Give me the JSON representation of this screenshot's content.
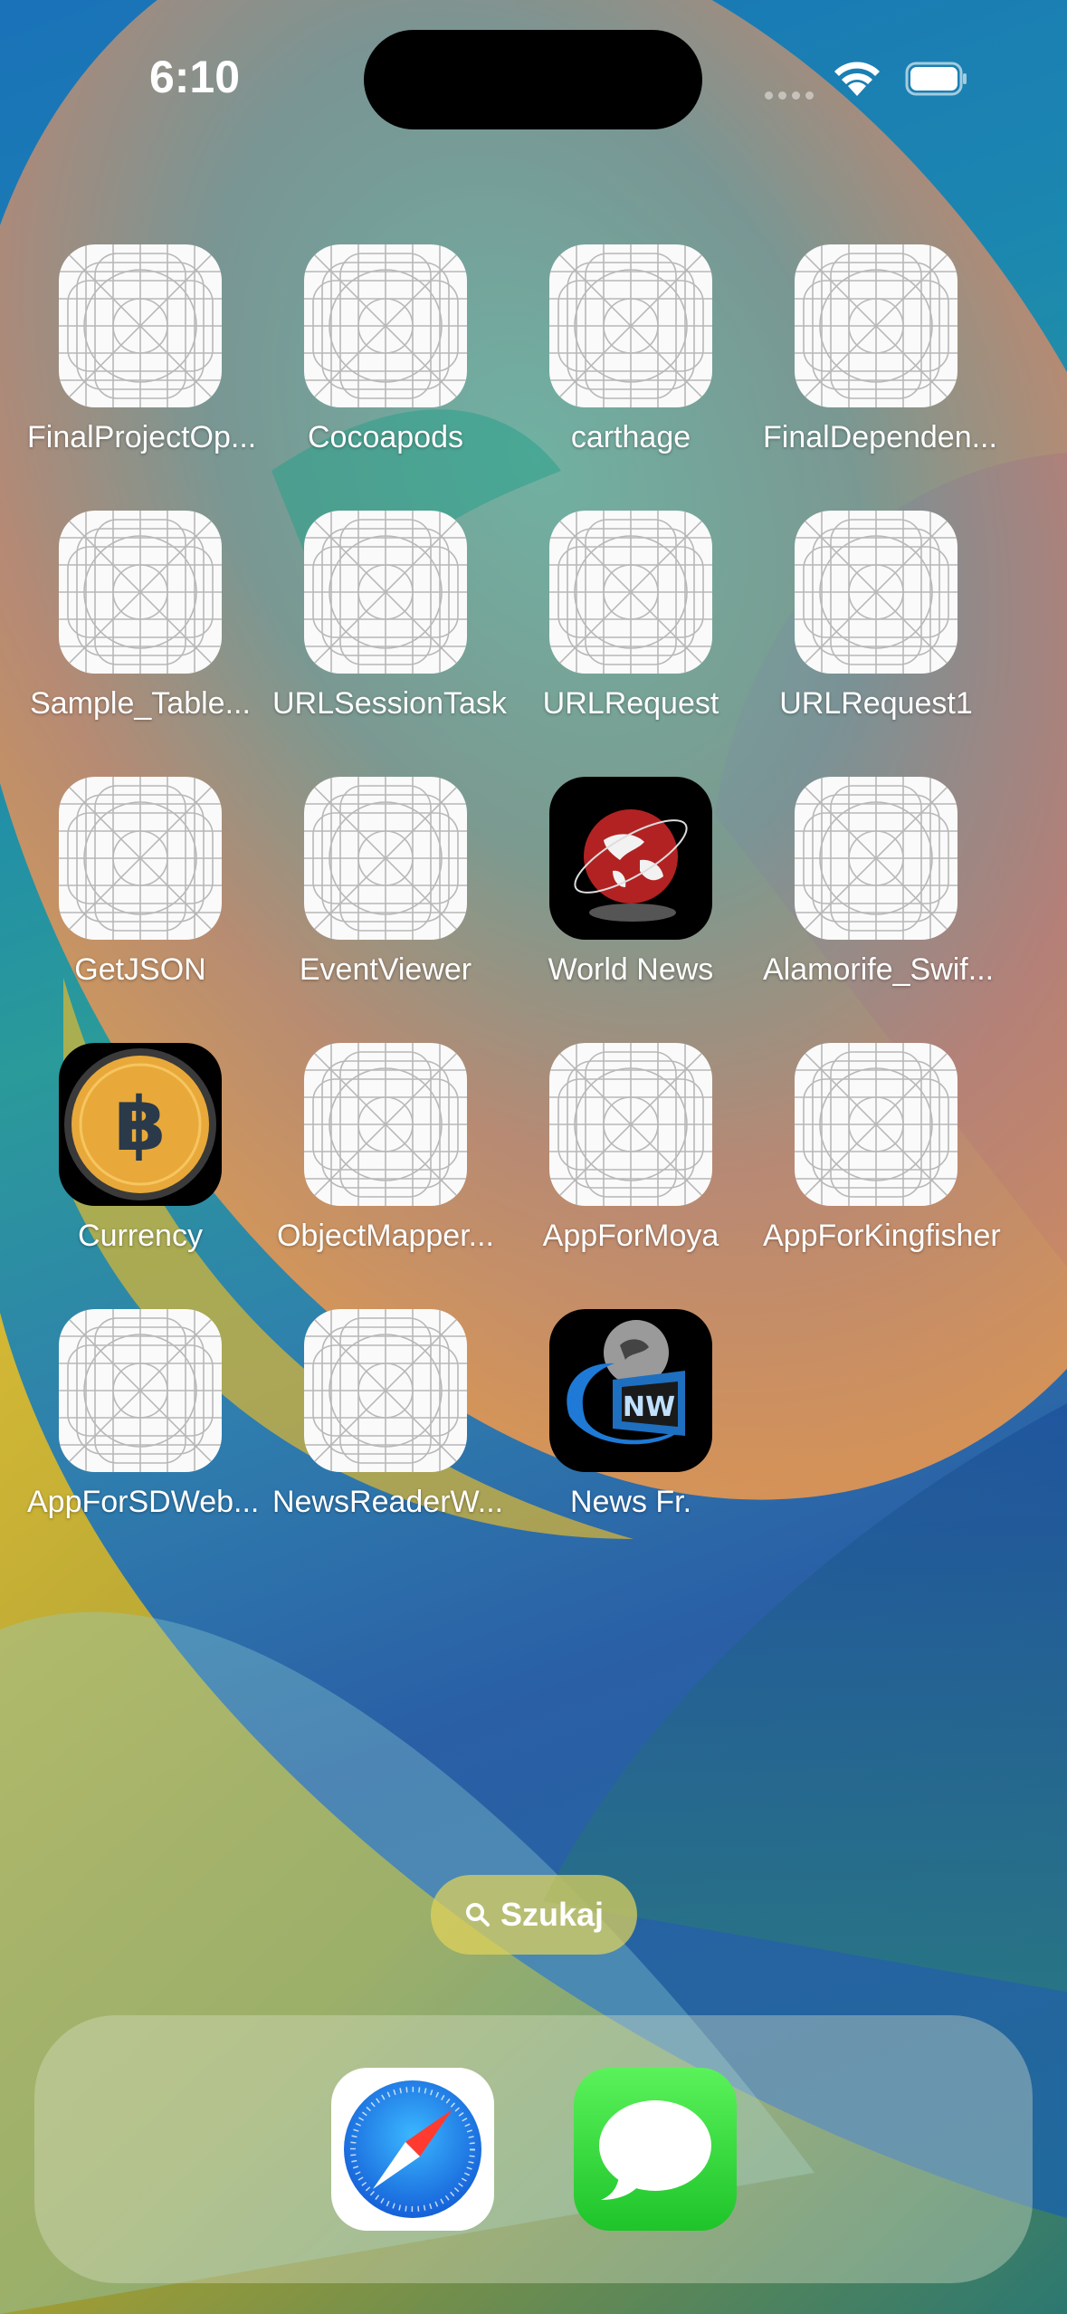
{
  "status_bar": {
    "time": "6:10"
  },
  "apps": [
    {
      "label": "FinalProjectOp...",
      "icon": "placeholder-app-icon"
    },
    {
      "label": "Cocoapods",
      "icon": "placeholder-app-icon"
    },
    {
      "label": "carthage",
      "icon": "placeholder-app-icon"
    },
    {
      "label": "FinalDependen...",
      "icon": "placeholder-app-icon"
    },
    {
      "label": "Sample_Table...",
      "icon": "placeholder-app-icon"
    },
    {
      "label": "URLSessionTask",
      "icon": "placeholder-app-icon"
    },
    {
      "label": "URLRequest",
      "icon": "placeholder-app-icon"
    },
    {
      "label": "URLRequest1",
      "icon": "placeholder-app-icon"
    },
    {
      "label": "GetJSON",
      "icon": "placeholder-app-icon"
    },
    {
      "label": "EventViewer",
      "icon": "placeholder-app-icon"
    },
    {
      "label": "World News",
      "icon": "globe-icon"
    },
    {
      "label": "Alamorife_Swif...",
      "icon": "placeholder-app-icon"
    },
    {
      "label": "Currency",
      "icon": "bitcoin-icon"
    },
    {
      "label": "ObjectMapper...",
      "icon": "placeholder-app-icon"
    },
    {
      "label": "AppForMoya",
      "icon": "placeholder-app-icon"
    },
    {
      "label": "AppForKingfisher",
      "icon": "placeholder-app-icon"
    },
    {
      "label": "AppForSDWeb...",
      "icon": "placeholder-app-icon"
    },
    {
      "label": "NewsReaderW...",
      "icon": "placeholder-app-icon"
    },
    {
      "label": "News Fr.",
      "icon": "news-globe-icon"
    }
  ],
  "search": {
    "label": "Szukaj"
  },
  "dock": [
    {
      "name": "Safari",
      "icon": "safari-compass-icon"
    },
    {
      "name": "Messages",
      "icon": "messages-bubble-icon"
    }
  ],
  "colors": {
    "messages_green": "#34c759",
    "safari_blue": "#1e88e5",
    "bitcoin_gold": "#e8a93a"
  }
}
